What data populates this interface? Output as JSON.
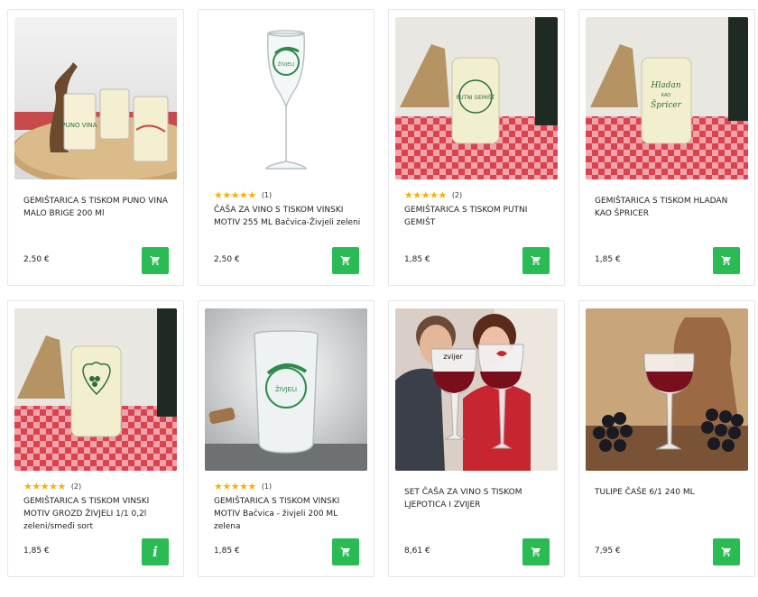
{
  "products": [
    {
      "name": "GEMIŠTARICA S TISKOM PUNO VINA MALO BRIGE 200 Ml",
      "price": "2,50 €",
      "stars": "",
      "rating_count": "",
      "action": "cart-icon"
    },
    {
      "name": "ČAŠA ZA VINO S TISKOM VINSKI MOTIV 255 ML Bačvica-Živjeli zeleni",
      "price": "2,50 €",
      "stars": "★★★★★",
      "rating_count": "(1)",
      "action": "cart-icon"
    },
    {
      "name": "GEMIŠTARICA S TISKOM PUTNI GEMIŠT",
      "price": "1,85 €",
      "stars": "★★★★★",
      "rating_count": "(2)",
      "action": "cart-icon"
    },
    {
      "name": "GEMIŠTARICA S TISKOM HLADAN KAO ŠPRICER",
      "price": "1,85 €",
      "stars": "",
      "rating_count": "",
      "action": "cart-icon"
    },
    {
      "name": "GEMIŠTARICA S TISKOM VINSKI MOTIV GROZD ŽIVJELI 1/1 0,2l zeleni/smeđi sort",
      "price": "1,85 €",
      "stars": "★★★★★",
      "rating_count": "(2)",
      "action": "info-icon"
    },
    {
      "name": "GEMIŠTARICA S TISKOM VINSKI MOTIV Bačvica - živjeli 200 ML zelena",
      "price": "1,85 €",
      "stars": "★★★★★",
      "rating_count": "(1)",
      "action": "cart-icon"
    },
    {
      "name": "SET ČAŠA ZA VINO S TISKOM LJEPOTICA I ZVIJER",
      "price": "8,61 €",
      "stars": "",
      "rating_count": "",
      "action": "cart-icon"
    },
    {
      "name": "TULIPE ČAŠE 6/1 240 ML",
      "price": "7,95 €",
      "stars": "",
      "rating_count": "",
      "action": "cart-icon"
    }
  ],
  "image_text": {
    "p1": "PUNO VINA",
    "p2": "ŽIVJELI",
    "p3": "PUTNI GEMIŠT",
    "p4_a": "Hladan",
    "p4_b": "KAO",
    "p4_c": "Špricer",
    "p6": "ŽIVJELI",
    "p7": "zvijer"
  },
  "colors": {
    "accent_button": "#2bbb55",
    "star": "#f3b10e",
    "print_green": "#2e8a4a"
  }
}
